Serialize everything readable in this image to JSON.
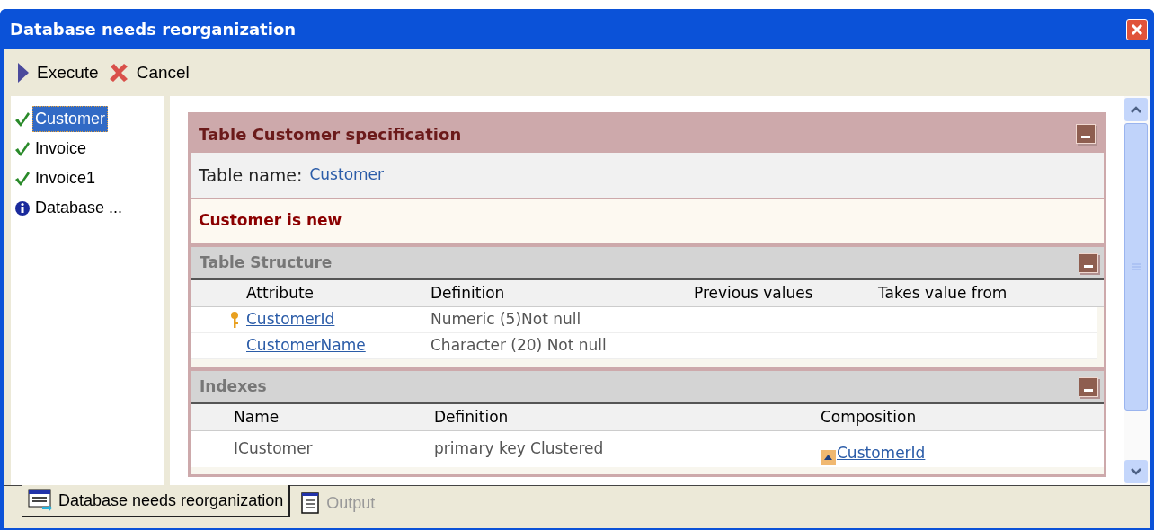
{
  "window": {
    "title": "Database needs reorganization"
  },
  "toolbar": [
    {
      "label": "Execute",
      "kind": "execute"
    },
    {
      "label": "Cancel",
      "kind": "cancel"
    }
  ],
  "sidebar": {
    "items": [
      {
        "label": "Customer",
        "kind": "ok",
        "selected": true
      },
      {
        "label": "Invoice",
        "kind": "ok",
        "selected": false
      },
      {
        "label": "Invoice1",
        "kind": "ok",
        "selected": false
      },
      {
        "label": "Database ...",
        "kind": "info",
        "selected": false
      }
    ]
  },
  "specification": {
    "title": "Table Customer specification",
    "table_name_label": "Table name:",
    "table_name": "Customer",
    "status": "Customer is new",
    "structure": {
      "title": "Table Structure",
      "columns": [
        "Attribute",
        "Definition",
        "Previous values",
        "Takes value from"
      ],
      "rows": [
        {
          "key": true,
          "attribute": "CustomerId",
          "definition": "Numeric (5)Not null"
        },
        {
          "key": false,
          "attribute": "CustomerName",
          "definition": "Character (20) Not null"
        }
      ]
    },
    "indexes": {
      "title": "Indexes",
      "columns": [
        "Name",
        "Definition",
        "Composition"
      ],
      "rows": [
        {
          "name": "ICustomer",
          "definition": "primary key Clustered",
          "composition": "CustomerId"
        }
      ]
    }
  },
  "bottom_tabs": [
    {
      "label": "Database needs reorganization",
      "selected": true
    },
    {
      "label": "Output",
      "selected": false
    }
  ]
}
